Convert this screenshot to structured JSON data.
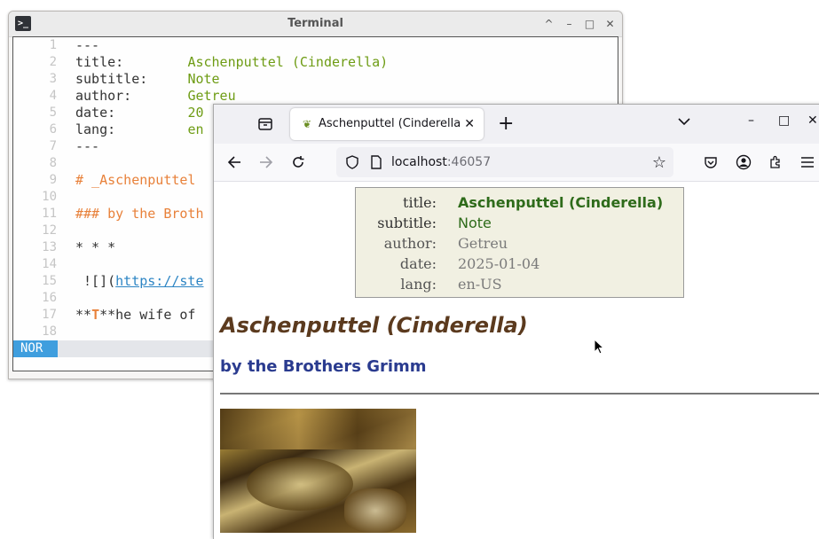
{
  "terminal": {
    "title": "Terminal",
    "app_icon": ">_",
    "controls": [
      "^",
      "–",
      "□",
      "✕"
    ],
    "lines": [
      {
        "n": "1",
        "parts": [
          {
            "t": "---",
            "c": ""
          }
        ]
      },
      {
        "n": "2",
        "parts": [
          {
            "t": "title:        ",
            "c": ""
          },
          {
            "t": "Aschenputtel (Cinderella)",
            "c": "v-green"
          }
        ]
      },
      {
        "n": "3",
        "parts": [
          {
            "t": "subtitle:     ",
            "c": ""
          },
          {
            "t": "Note",
            "c": "v-green"
          }
        ]
      },
      {
        "n": "4",
        "parts": [
          {
            "t": "author:       ",
            "c": ""
          },
          {
            "t": "Getreu",
            "c": "v-green"
          }
        ]
      },
      {
        "n": "5",
        "parts": [
          {
            "t": "date:         ",
            "c": ""
          },
          {
            "t": "20",
            "c": "v-green"
          }
        ]
      },
      {
        "n": "6",
        "parts": [
          {
            "t": "lang:         ",
            "c": ""
          },
          {
            "t": "en",
            "c": "v-green"
          }
        ]
      },
      {
        "n": "7",
        "parts": [
          {
            "t": "---",
            "c": ""
          }
        ]
      },
      {
        "n": "8",
        "parts": []
      },
      {
        "n": "9",
        "parts": [
          {
            "t": "# _Aschenputtel",
            "c": "v-orange"
          }
        ]
      },
      {
        "n": "10",
        "parts": []
      },
      {
        "n": "11",
        "parts": [
          {
            "t": "### by the Broth",
            "c": "v-orange"
          }
        ]
      },
      {
        "n": "12",
        "parts": []
      },
      {
        "n": "13",
        "parts": [
          {
            "t": "* * *",
            "c": ""
          }
        ]
      },
      {
        "n": "14",
        "parts": []
      },
      {
        "n": "15",
        "parts": [
          {
            "t": " ![](",
            "c": ""
          },
          {
            "t": "https://ste",
            "c": "v-link"
          }
        ]
      },
      {
        "n": "16",
        "parts": []
      },
      {
        "n": "17",
        "parts": [
          {
            "t": "**",
            "c": ""
          },
          {
            "t": "T",
            "c": "v-bold-orange"
          },
          {
            "t": "**he wife of",
            "c": ""
          }
        ]
      },
      {
        "n": "18",
        "parts": []
      }
    ],
    "mode": "NOR"
  },
  "browser": {
    "tab_title": "Aschenputtel (Cinderella",
    "tab_close": "✕",
    "new_tab": "+",
    "tabs_menu": "⌵",
    "window_controls": [
      "–",
      "□",
      "✕"
    ],
    "url_host": "localhost",
    "url_port": ":46057",
    "icons": {
      "back": "back-arrow-icon",
      "forward": "forward-arrow-icon",
      "reload": "reload-icon",
      "shield": "shield-icon",
      "page": "page-icon",
      "star": "bookmark-star-icon",
      "pocket": "pocket-icon",
      "account": "account-icon",
      "extensions": "extensions-icon",
      "menu": "hamburger-menu-icon"
    }
  },
  "page": {
    "meta": [
      {
        "key": "title:",
        "value": "Aschenputtel (Cinderella)",
        "vc": "mv-title",
        "kc": "mk-strong"
      },
      {
        "key": "subtitle:",
        "value": "Note",
        "vc": "mv-sub",
        "kc": "mk-strong"
      },
      {
        "key": "author:",
        "value": "Getreu",
        "vc": "mv-grey",
        "kc": ""
      },
      {
        "key": "date:",
        "value": "2025-01-04",
        "vc": "mv-grey",
        "kc": ""
      },
      {
        "key": "lang:",
        "value": "en-US",
        "vc": "mv-grey",
        "kc": ""
      }
    ],
    "heading": "Aschenputtel (Cinderella)",
    "subheading": "by the Brothers Grimm"
  }
}
